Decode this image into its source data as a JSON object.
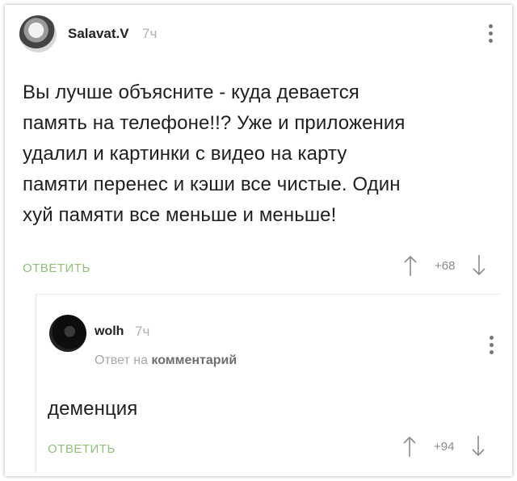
{
  "comment": {
    "author": "Salavat.V",
    "time": "7ч",
    "text_lines": [
      "Вы лучше объясните - куда девается",
      "память на телефоне!!? Уже и приложения",
      "удалил и картинки с видео на карту",
      "памяти перенес и кэши все чистые. Один",
      "хуй памяти все меньше и меньше!"
    ],
    "reply_label": "ОТВЕТИТЬ",
    "score": "+68",
    "avatar_icon": "user-avatar",
    "menu_icon": "more-vertical-icon"
  },
  "reply": {
    "author": "wolh",
    "time": "7ч",
    "reply_to_prefix": "Ответ на",
    "reply_to_target": "комментарий",
    "text": "деменция",
    "reply_label": "ОТВЕТИТЬ",
    "score": "+94",
    "avatar_icon": "user-avatar",
    "menu_icon": "more-vertical-icon"
  },
  "colors": {
    "accent_green": "#8ec07a",
    "muted_text": "#a8a8a8",
    "arrow_gray": "#8a8a8a"
  }
}
